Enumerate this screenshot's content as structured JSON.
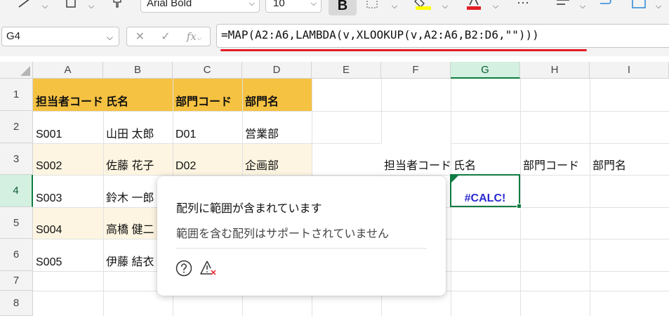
{
  "ribbon": {
    "font_name": "Arial Bold",
    "font_size": "10",
    "bold_label": "B"
  },
  "formula_bar": {
    "name_box": "G4",
    "fx_label": "fx",
    "formula": "=MAP(A2:A6,LAMBDA(v,XLOOKUP(v,A2:A6,B2:D6,\"\")))"
  },
  "sheet": {
    "columns": [
      "A",
      "B",
      "C",
      "D",
      "E",
      "F",
      "G",
      "H",
      "I"
    ],
    "selected_column": "G",
    "rows": [
      "1",
      "2",
      "3",
      "4",
      "5",
      "6",
      "7",
      "8"
    ],
    "selected_row": "4",
    "table_headers": [
      "担当者コード",
      "氏名",
      "部門コード",
      "部門名"
    ],
    "table_rows": [
      [
        "S001",
        "山田 太郎",
        "D01",
        "営業部"
      ],
      [
        "S002",
        "佐藤 花子",
        "D02",
        "企画部"
      ],
      [
        "S003",
        "鈴木 一郎",
        "",
        ""
      ],
      [
        "S004",
        "高橋 健二",
        "",
        ""
      ],
      [
        "S005",
        "伊藤 結衣",
        "",
        ""
      ]
    ],
    "lookup_headers": [
      "担当者コード",
      "氏名",
      "部門コード",
      "部門名"
    ],
    "error_value": "#CALC!",
    "colors": {
      "header_fill": "#f5c242",
      "band_fill": "#fdf5e1",
      "selection": "#107c41",
      "error_text": "#2a2ad0"
    }
  },
  "popup": {
    "title": "配列に範囲が含まれています",
    "description": "範囲を含む配列はサポートされていません",
    "icons": [
      "help-icon",
      "error-trace-icon"
    ]
  }
}
